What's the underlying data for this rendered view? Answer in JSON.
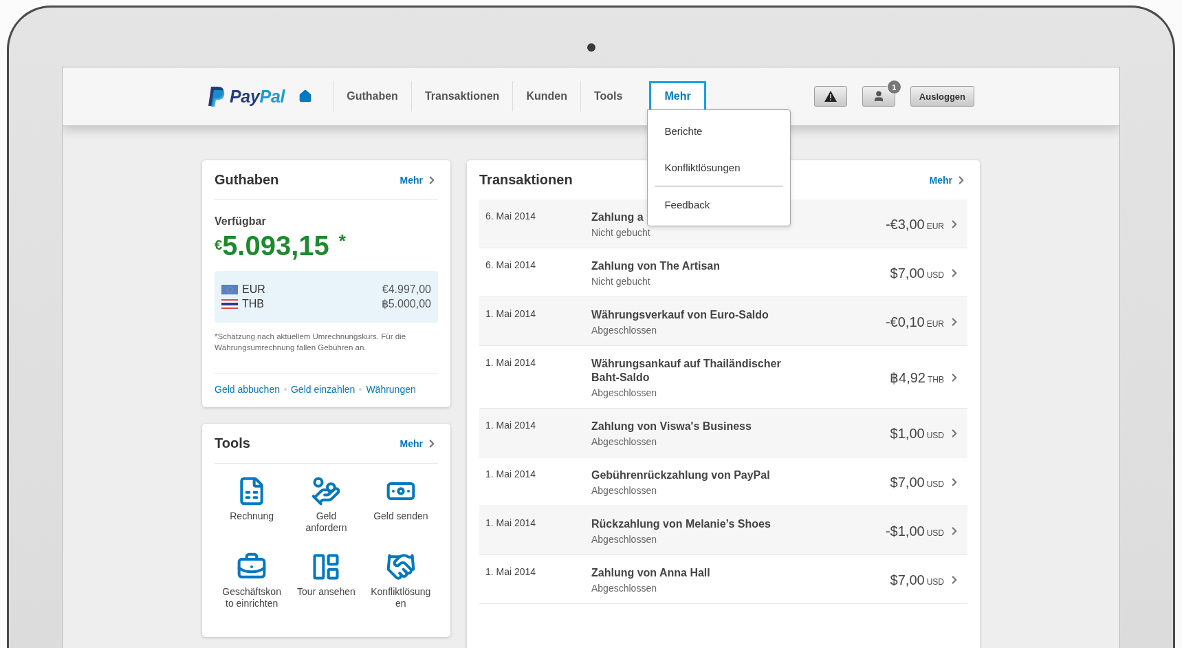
{
  "logo": {
    "parts": [
      "Pay",
      "Pal"
    ]
  },
  "nav": {
    "items": [
      {
        "label": "Guthaben",
        "selected": false
      },
      {
        "label": "Transaktionen",
        "selected": false
      },
      {
        "label": "Kunden",
        "selected": false
      },
      {
        "label": "Tools",
        "selected": false
      },
      {
        "label": "Mehr",
        "selected": true
      }
    ],
    "menu": [
      {
        "kind": "item",
        "label": "Berichte"
      },
      {
        "kind": "item",
        "label": "Konfliktlösungen"
      },
      {
        "kind": "divider"
      },
      {
        "kind": "item",
        "label": "Feedback"
      }
    ],
    "notification_badge": "1",
    "logout": "Ausloggen"
  },
  "balance_card": {
    "title": "Guthaben",
    "more": "Mehr",
    "available_label": "Verfügbar",
    "currency_symbol": "€",
    "amount": "5.093,15",
    "note_mark": "*",
    "currencies": [
      {
        "kind": "eu",
        "code": "EUR",
        "amount": "€4.997,00"
      },
      {
        "kind": "th",
        "code": "THB",
        "amount": "฿5.000,00"
      }
    ],
    "note": "*Schätzung nach aktuellem Umrechnungskurs. Für die Währungsumrechnung fallen Gebühren an.",
    "links": [
      "Geld abbuchen",
      "Geld einzahlen",
      "Währungen"
    ]
  },
  "tools_card": {
    "title": "Tools",
    "more": "Mehr",
    "tools": [
      {
        "kind": "invoice",
        "label": "Rechnung"
      },
      {
        "kind": "request",
        "label": "Geld anfordern"
      },
      {
        "kind": "send",
        "label": "Geld senden"
      },
      {
        "kind": "setup",
        "label": "Geschäftskon to einrichten"
      },
      {
        "kind": "tour",
        "label": "Tour ansehen"
      },
      {
        "kind": "resolve",
        "label": "Konfliktlösung en"
      }
    ]
  },
  "transactions_card": {
    "title": "Transaktionen",
    "more": "Mehr",
    "rows": [
      {
        "date": "6. Mai 2014",
        "title": "Zahlung a",
        "status": "Nicht gebucht",
        "amount": "-€3,00",
        "currency": "EUR"
      },
      {
        "date": "6. Mai 2014",
        "title": "Zahlung von The Artisan",
        "status": "Nicht gebucht",
        "amount": "$7,00",
        "currency": "USD"
      },
      {
        "date": "1. Mai 2014",
        "title": "Währungsverkauf von Euro-Saldo",
        "status": "Abgeschlossen",
        "amount": "-€0,10",
        "currency": "EUR"
      },
      {
        "date": "1. Mai 2014",
        "title": "Währungsankauf auf Thailändischer Baht-Saldo",
        "status": "Abgeschlossen",
        "amount": "฿4,92",
        "currency": "THB"
      },
      {
        "date": "1. Mai 2014",
        "title": "Zahlung von Viswa's Business",
        "status": "Abgeschlossen",
        "amount": "$1,00",
        "currency": "USD"
      },
      {
        "date": "1. Mai 2014",
        "title": "Gebührenrückzahlung von PayPal",
        "status": "Abgeschlossen",
        "amount": "$7,00",
        "currency": "USD"
      },
      {
        "date": "1. Mai 2014",
        "title": "Rückzahlung von Melanie’s Shoes",
        "status": "Abgeschlossen",
        "amount": "-$1,00",
        "currency": "USD"
      },
      {
        "date": "1. Mai 2014",
        "title": "Zahlung von Anna Hall",
        "status": "Abgeschlossen",
        "amount": "$7,00",
        "currency": "USD"
      }
    ]
  }
}
